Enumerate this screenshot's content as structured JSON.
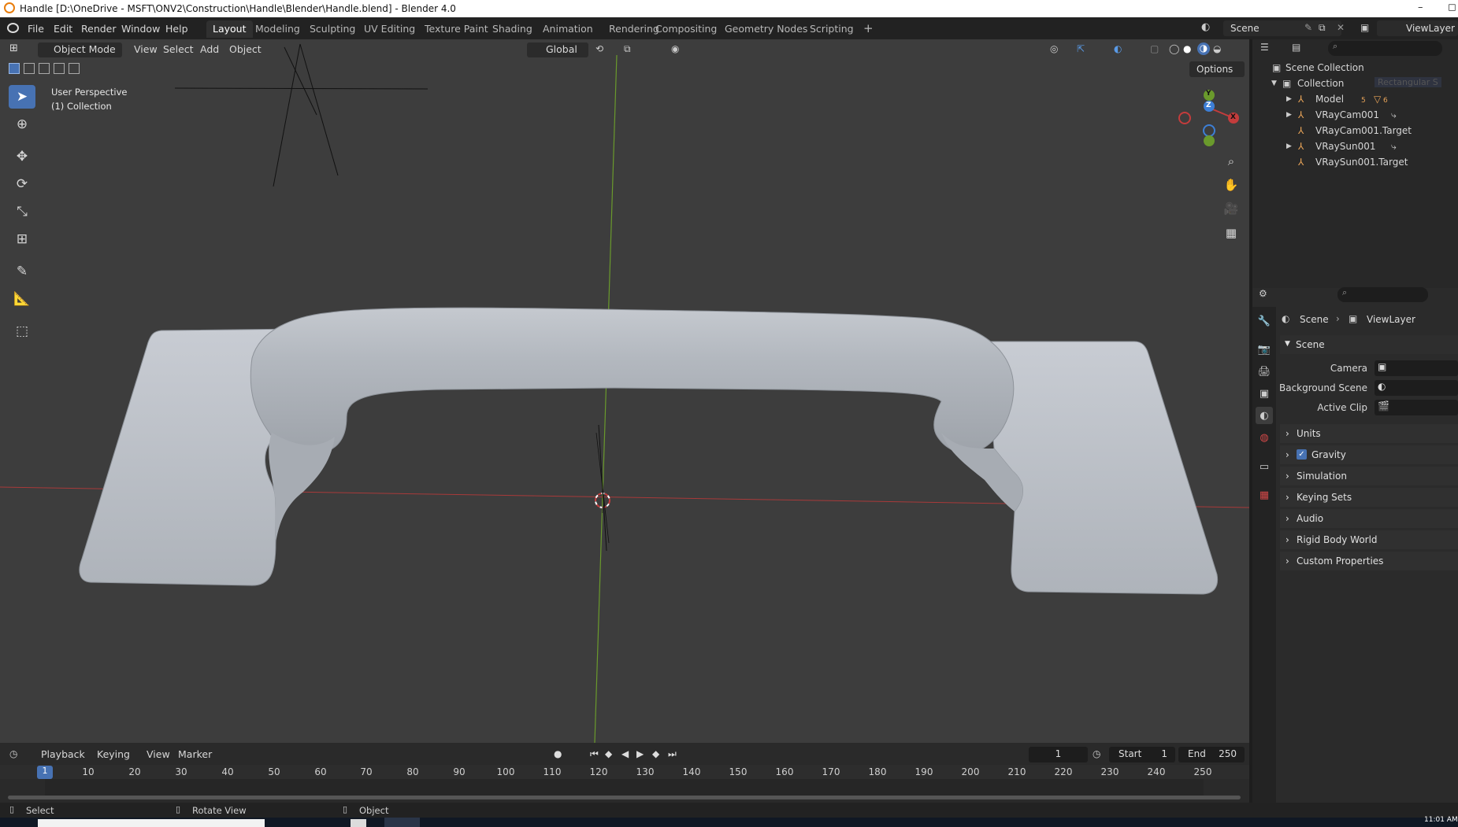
{
  "window": {
    "title": "Handle [D:\\OneDrive - MSFT\\ONV2\\Construction\\Handle\\Blender\\Handle.blend] - Blender 4.0",
    "minimize": "–",
    "maximize": "◻"
  },
  "menus": [
    "File",
    "Edit",
    "Render",
    "Window",
    "Help"
  ],
  "workspaces": [
    "Layout",
    "Modeling",
    "Sculpting",
    "UV Editing",
    "Texture Paint",
    "Shading",
    "Animation",
    "Rendering",
    "Compositing",
    "Geometry Nodes",
    "Scripting"
  ],
  "workspace_add": "+",
  "scene_name": "Scene",
  "view_layer": "ViewLayer",
  "viewport": {
    "mode": "Object Mode",
    "menus": [
      "View",
      "Select",
      "Add",
      "Object"
    ],
    "transform_orientation": "Global",
    "options_label": "Options",
    "overlay_line1": "User Perspective",
    "overlay_line2": "(1) Collection",
    "gizmo": {
      "x": "X",
      "y": "Y",
      "z": "Z"
    }
  },
  "outliner": {
    "root": "Scene Collection",
    "collection": "Collection",
    "items": [
      "Model",
      "VRayCam001",
      "VRayCam001.Target",
      "VRaySun001",
      "VRaySun001.Target"
    ],
    "model_badges": [
      "5",
      "6"
    ],
    "ghost_label": "Rectangular S"
  },
  "properties": {
    "breadcrumb_scene": "Scene",
    "breadcrumb_layer": "ViewLayer",
    "section": "Scene",
    "camera_label": "Camera",
    "background_scene_label": "Background Scene",
    "active_clip_label": "Active Clip",
    "panels": [
      "Units",
      "Gravity",
      "Simulation",
      "Keying Sets",
      "Audio",
      "Rigid Body World",
      "Custom Properties"
    ]
  },
  "timeline": {
    "menus": [
      "Playback",
      "Keying",
      "View",
      "Marker"
    ],
    "current_frame": "1",
    "start_label": "Start",
    "start": "1",
    "end_label": "End",
    "end": "250",
    "ticks": [
      "10",
      "20",
      "30",
      "40",
      "50",
      "60",
      "70",
      "80",
      "90",
      "100",
      "110",
      "120",
      "130",
      "140",
      "150",
      "160",
      "170",
      "180",
      "190",
      "200",
      "210",
      "220",
      "230",
      "240",
      "250"
    ],
    "playhead": "1"
  },
  "statusbar": {
    "left": "Select",
    "middle": "Rotate View",
    "right": "Object",
    "clock": "11:01 AM"
  },
  "colors": {
    "accent": "#4772b3",
    "x_axis": "#c33c3c",
    "y_axis": "#6a9a2c",
    "object_orange": "#e9a458"
  }
}
